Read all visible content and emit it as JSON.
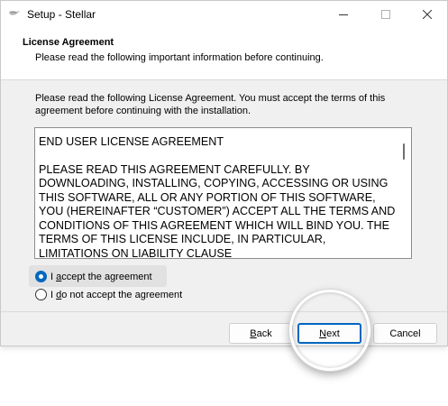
{
  "window": {
    "title": "Setup - Stellar",
    "icons": {
      "app": "stellar-app-icon",
      "minimize": "minimize-icon",
      "maximize": "maximize-icon",
      "close": "close-icon"
    }
  },
  "header": {
    "title": "License Agreement",
    "subtitle": "Please read the following important information before continuing."
  },
  "intro": "Please read the following License Agreement. You must accept the terms of this agreement before continuing with the installation.",
  "license": {
    "heading": "END USER LICENSE AGREEMENT",
    "body": "PLEASE READ THIS AGREEMENT CAREFULLY. BY DOWNLOADING, INSTALLING, COPYING, ACCESSING OR USING THIS SOFTWARE, ALL OR ANY PORTION OF THIS SOFTWARE, YOU (HEREINAFTER “CUSTOMER”) ACCEPT ALL THE TERMS AND CONDITIONS OF THIS AGREEMENT WHICH WILL BIND YOU. THE TERMS OF THIS LICENSE INCLUDE, IN PARTICULAR, LIMITATIONS ON LIABILITY CLAUSE"
  },
  "options": {
    "accept": {
      "label_prefix": "I ",
      "label_hotkey": "a",
      "label_rest": "ccept the agreement",
      "checked": true
    },
    "decline": {
      "label_prefix": "I ",
      "label_hotkey": "d",
      "label_rest": "o not accept the agreement",
      "checked": false
    }
  },
  "buttons": {
    "back": {
      "hotkey": "B",
      "rest": "ack"
    },
    "next": {
      "hotkey": "N",
      "rest": "ext"
    },
    "cancel": "Cancel"
  },
  "colors": {
    "accent": "#0067c0",
    "window_bg": "#f0f0f0",
    "header_bg": "#ffffff"
  }
}
